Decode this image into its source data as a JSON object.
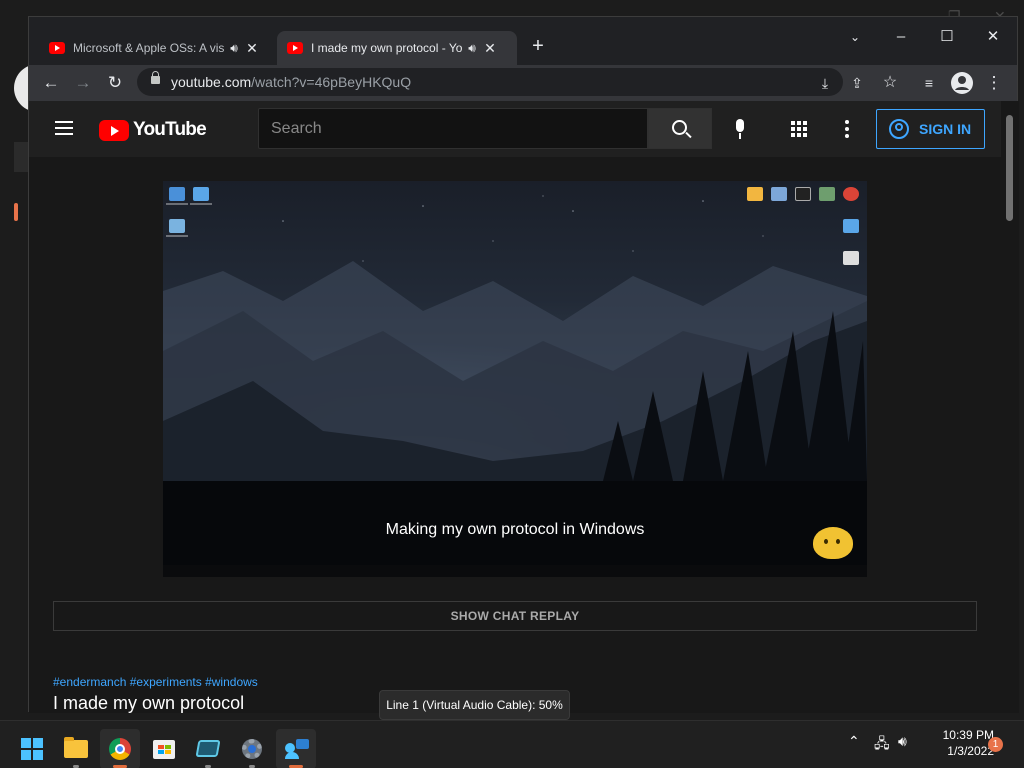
{
  "browser": {
    "tabs": [
      {
        "title": "Microsoft & Apple OSs: A vis",
        "active": false
      },
      {
        "title": "I made my own protocol - Yo",
        "active": true
      }
    ],
    "new_tab_label": "+",
    "url_host": "youtube.com",
    "url_path": "/watch?v=46pBeyHKQuQ"
  },
  "youtube": {
    "logo_text": "YouTube",
    "search_placeholder": "Search",
    "sign_in_label": "SIGN IN",
    "video_caption": "Making my own protocol in Windows",
    "chat_replay_label": "SHOW CHAT REPLAY",
    "hashtags": "#endermanch #experiments #windows",
    "video_title": "I made my own protocol"
  },
  "tooltip": "Line 1 (Virtual Audio Cable): 50%",
  "taskbar": {
    "apps": [
      "start-icon",
      "file-explorer-icon",
      "chrome-icon",
      "microsoft-store-icon",
      "virtual-machine-icon",
      "settings-icon",
      "remote-desktop-icon"
    ],
    "time": "10:39 PM",
    "date": "1/3/2022",
    "notification_count": "1"
  },
  "colors": {
    "youtube_red": "#ff0000",
    "link_blue": "#3ea6ff",
    "taskbar_bg": "#202020",
    "active_indicator": "#e06c3c"
  }
}
